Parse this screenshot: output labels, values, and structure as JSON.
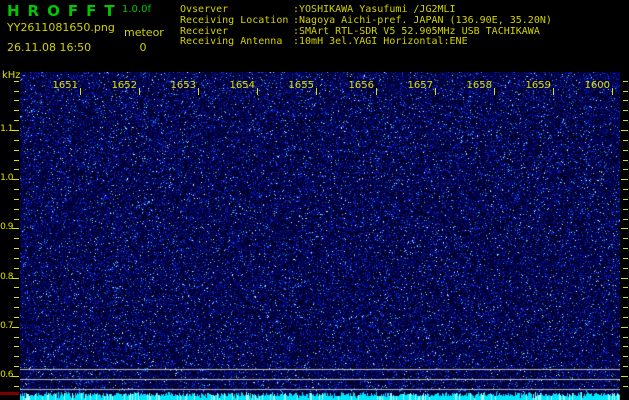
{
  "header": {
    "title": "HROFFT",
    "version": "1.0.0f",
    "filename": "YY2611081650.png",
    "mode_label": "meteor",
    "datetime": "26.11.08 16:50",
    "meteor_count": "0",
    "info_rows": [
      {
        "label": "Ovserver",
        "value": ":YOSHIKAWA Yasufumi /JG2MLI"
      },
      {
        "label": "Receiving Location",
        "value": ":Nagoya Aichi-pref. JAPAN (136.90E, 35.20N)"
      },
      {
        "label": "Receiver",
        "value": ":SMArt RTL-SDR V5 52.905MHz USB TACHIKAWA"
      },
      {
        "label": "Receiving Antenna",
        "value": ":10mH 3el.YAGI Horizontal:ENE"
      }
    ]
  },
  "spectrogram": {
    "unit_label": "kHz",
    "freq_major_labels": [
      "1.1",
      "1.0",
      "0.9",
      "0.8",
      "0.7",
      "0.6"
    ],
    "time_labels": [
      "1651",
      "1652",
      "1653",
      "1654",
      "1655",
      "1656",
      "1657",
      "1658",
      "1659",
      "1600"
    ],
    "description": "blue background noise field, no meteor echoes, three gray level reference lines near bottom, cyan signal-level band along bottom edge",
    "colors": {
      "title_green": "#00c800",
      "header_yellow": "#d2d200",
      "axis_yellow": "#e0e000",
      "level_line_gray": "#b9b9b9",
      "band_cyan": "#00e6ff",
      "band_cyan_bright": "#9cffff",
      "corner_red": "#7d0000"
    },
    "noise_seed": 987654321
  }
}
